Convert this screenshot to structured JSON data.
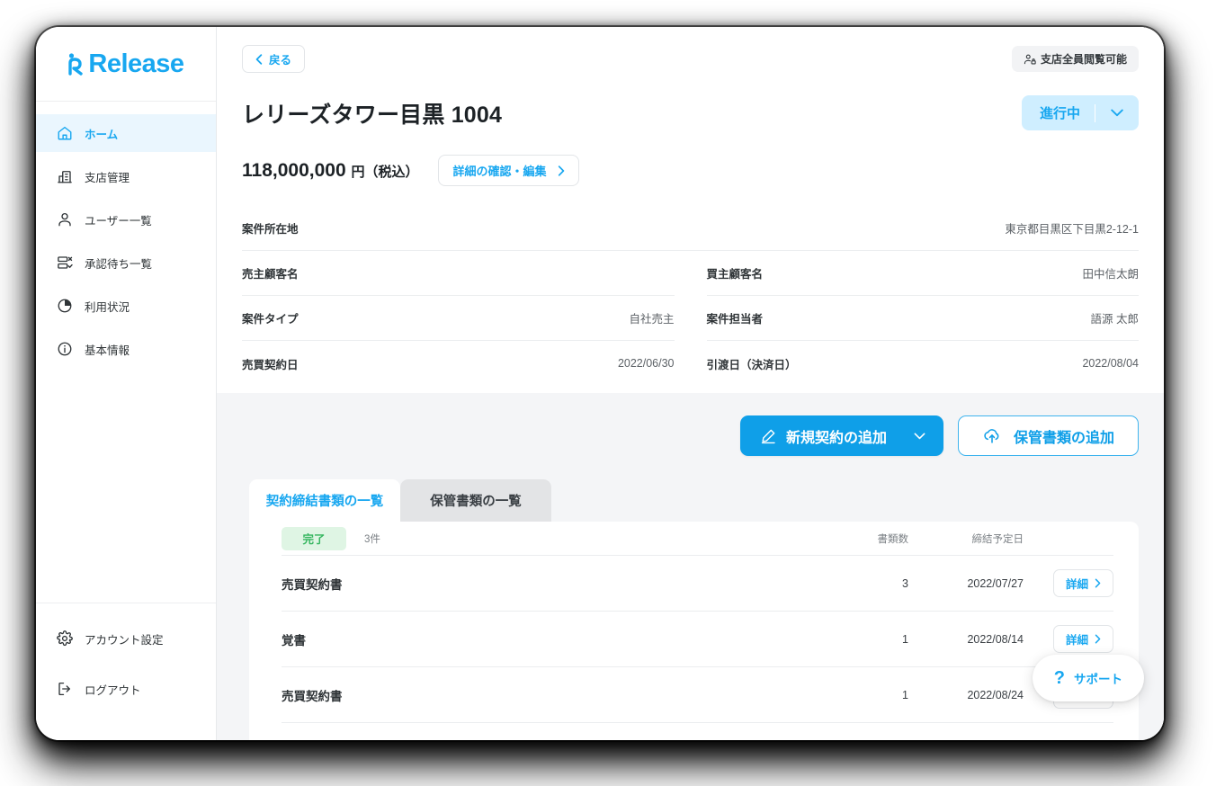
{
  "brand": {
    "name": "Release"
  },
  "sidebar": {
    "items": [
      {
        "label": "ホーム",
        "icon": "home-icon",
        "active": true
      },
      {
        "label": "支店管理",
        "icon": "building-icon",
        "active": false
      },
      {
        "label": "ユーザー一覧",
        "icon": "user-icon",
        "active": false
      },
      {
        "label": "承認待ち一覧",
        "icon": "approval-list-icon",
        "active": false
      },
      {
        "label": "利用状況",
        "icon": "pie-chart-icon",
        "active": false
      },
      {
        "label": "基本情報",
        "icon": "info-icon",
        "active": false
      }
    ],
    "bottom_items": [
      {
        "label": "アカウント設定",
        "icon": "gear-icon"
      },
      {
        "label": "ログアウト",
        "icon": "logout-icon"
      }
    ]
  },
  "header": {
    "back_label": "戻る",
    "visibility_badge": "支店全員閲覧可能",
    "title": "レリーズタワー目黒 1004",
    "status_label": "進行中",
    "price": "118,000,000",
    "price_unit": "円（税込）",
    "edit_label": "詳細の確認・編集"
  },
  "details": {
    "location": {
      "label": "案件所在地",
      "value": "東京都目黒区下目黒2-12-1"
    },
    "rows": [
      {
        "label": "売主顧客名",
        "value": ""
      },
      {
        "label": "買主顧客名",
        "value": "田中信太朗"
      },
      {
        "label": "案件タイプ",
        "value": "自社売主"
      },
      {
        "label": "案件担当者",
        "value": "語源 太郎"
      },
      {
        "label": "売買契約日",
        "value": "2022/06/30"
      },
      {
        "label": "引渡日（決済日）",
        "value": "2022/08/04"
      }
    ]
  },
  "actions": {
    "new_contract": "新規契約の追加",
    "add_storage_doc": "保管書類の追加"
  },
  "tabs": [
    {
      "label": "契約締結書類の一覧",
      "active": true
    },
    {
      "label": "保管書類の一覧",
      "active": false
    }
  ],
  "table": {
    "status_chip": "完了",
    "count": "3件",
    "columns": {
      "docs": "書類数",
      "date": "締結予定日"
    },
    "detail_label": "詳細",
    "rows": [
      {
        "name": "売買契約書",
        "docs": "3",
        "date": "2022/07/27"
      },
      {
        "name": "覚書",
        "docs": "1",
        "date": "2022/08/14"
      },
      {
        "name": "売買契約書",
        "docs": "1",
        "date": "2022/08/24"
      }
    ]
  },
  "support": {
    "label": "サポート",
    "icon": "question-mark-icon"
  },
  "colors": {
    "accent": "#18a7f0",
    "primary_button": "#0f9fe8",
    "status_pill_bg": "#cfeeff",
    "success_chip_bg": "#dff5e4",
    "success_chip_text": "#35b65f",
    "page_bg": "#f4f5f7"
  }
}
